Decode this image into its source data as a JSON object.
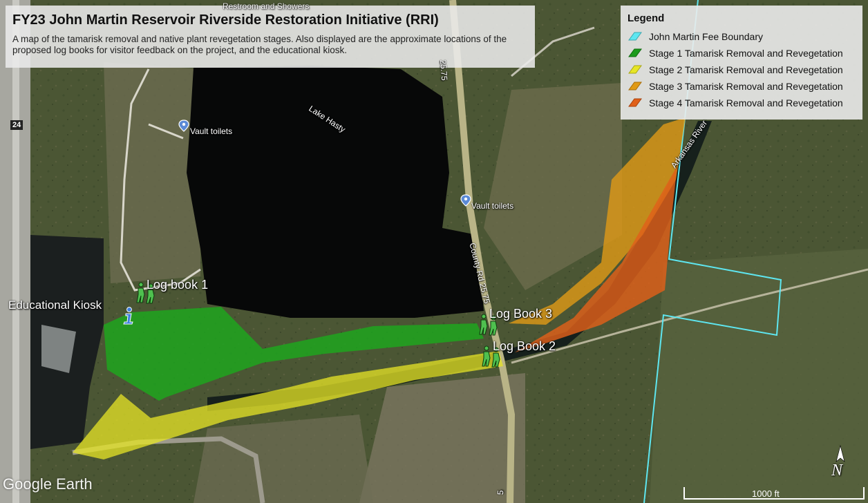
{
  "title": "FY23 John Martin Reservoir Riverside Restoration Initiative (RRI)",
  "subtitle": "A map of the tamarisk removal and native plant revegetation stages. Also displayed are the approximate locations of the proposed log books for visitor feedback on the project, and the educational kiosk.",
  "legend": {
    "title": "Legend",
    "items": [
      {
        "label": "John Martin Fee Boundary",
        "color": "#5ee6f0"
      },
      {
        "label": "Stage 1 Tamarisk Removal and Revegetation",
        "color": "#1c9b1c"
      },
      {
        "label": "Stage 2 Tamarisk Removal and Revegetation",
        "color": "#e7e626"
      },
      {
        "label": "Stage 3 Tamarisk Removal and Revegetation",
        "color": "#e09a16"
      },
      {
        "label": "Stage 4 Tamarisk Removal and Revegetation",
        "color": "#e0601a"
      }
    ]
  },
  "places": {
    "lake": "Lake Hasty",
    "river": "Arkansas River",
    "road": "County Rd 25.75",
    "road_top": "25.75",
    "road_bottom": "5",
    "vault1": "Vault toilets",
    "vault2": "Vault toilets",
    "top_partial": "Restroom and Showers",
    "highway": "24"
  },
  "markers": {
    "kiosk": "Educational Kiosk",
    "log1": "Log book 1",
    "log2": "Log Book 2",
    "log3": "Log Book 3"
  },
  "brand": "Google Earth",
  "scale_label": "1000 ft",
  "north": "N"
}
